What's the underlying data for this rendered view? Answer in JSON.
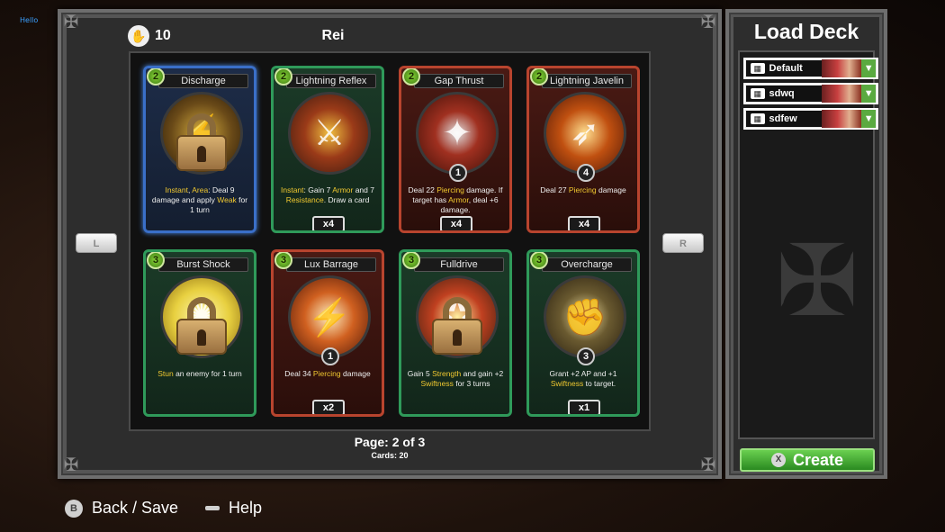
{
  "debug_text": "Hello",
  "header": {
    "card_count": "10",
    "character_name": "Rei"
  },
  "cards": [
    {
      "name": "Discharge",
      "cost": "2",
      "frame": "blue",
      "locked": true,
      "desc": "Instant, Area: Deal 9 damage and apply Weak for 1 turn",
      "mark": "",
      "qty": ""
    },
    {
      "name": "Lightning Reflex",
      "cost": "2",
      "frame": "green",
      "locked": false,
      "desc": "Instant: Gain 7 Armor and 7 Resistance. Draw a card",
      "mark": "",
      "qty": "x4"
    },
    {
      "name": "Gap Thrust",
      "cost": "2",
      "frame": "red",
      "locked": false,
      "desc": "Deal 22 Piercing damage. If target has Armor, deal +6 damage.",
      "mark": "1",
      "qty": "x4"
    },
    {
      "name": "Lightning Javelin",
      "cost": "2",
      "frame": "red",
      "locked": false,
      "desc": "Deal 27 Piercing damage",
      "mark": "4",
      "qty": "x4"
    },
    {
      "name": "Burst Shock",
      "cost": "3",
      "frame": "green",
      "locked": true,
      "desc": "Stun an enemy for 1 turn",
      "mark": "",
      "qty": ""
    },
    {
      "name": "Lux Barrage",
      "cost": "3",
      "frame": "red",
      "locked": false,
      "desc": "Deal 34 Piercing damage",
      "mark": "1",
      "qty": "x2"
    },
    {
      "name": "Fulldrive",
      "cost": "3",
      "frame": "green",
      "locked": true,
      "desc": "Gain 5 Strength and gain +2 Swiftness for 3 turns",
      "mark": "",
      "qty": ""
    },
    {
      "name": "Overcharge",
      "cost": "3",
      "frame": "green",
      "locked": false,
      "desc": "Grant +2 AP and +1 Swiftness to target.",
      "mark": "3",
      "qty": "x1"
    }
  ],
  "pagination": {
    "page_label": "Page: 2 of 3",
    "cards_label": "Cards: 20",
    "left_button": "L",
    "right_button": "R"
  },
  "load_deck": {
    "title": "Load Deck",
    "decks": [
      {
        "name": "Default"
      },
      {
        "name": "sdwq"
      },
      {
        "name": "sdfew"
      }
    ],
    "create_label": "Create",
    "create_button_glyph": "X"
  },
  "footer": {
    "back_button_glyph": "B",
    "back_label": "Back / Save",
    "help_label": "Help"
  },
  "colors": {
    "accent_green": "#5aaa40",
    "card_blue": "#3a6fc8",
    "card_green": "#2f9a5a",
    "card_red": "#b8442e",
    "keyword_yellow": "#f0c830"
  }
}
